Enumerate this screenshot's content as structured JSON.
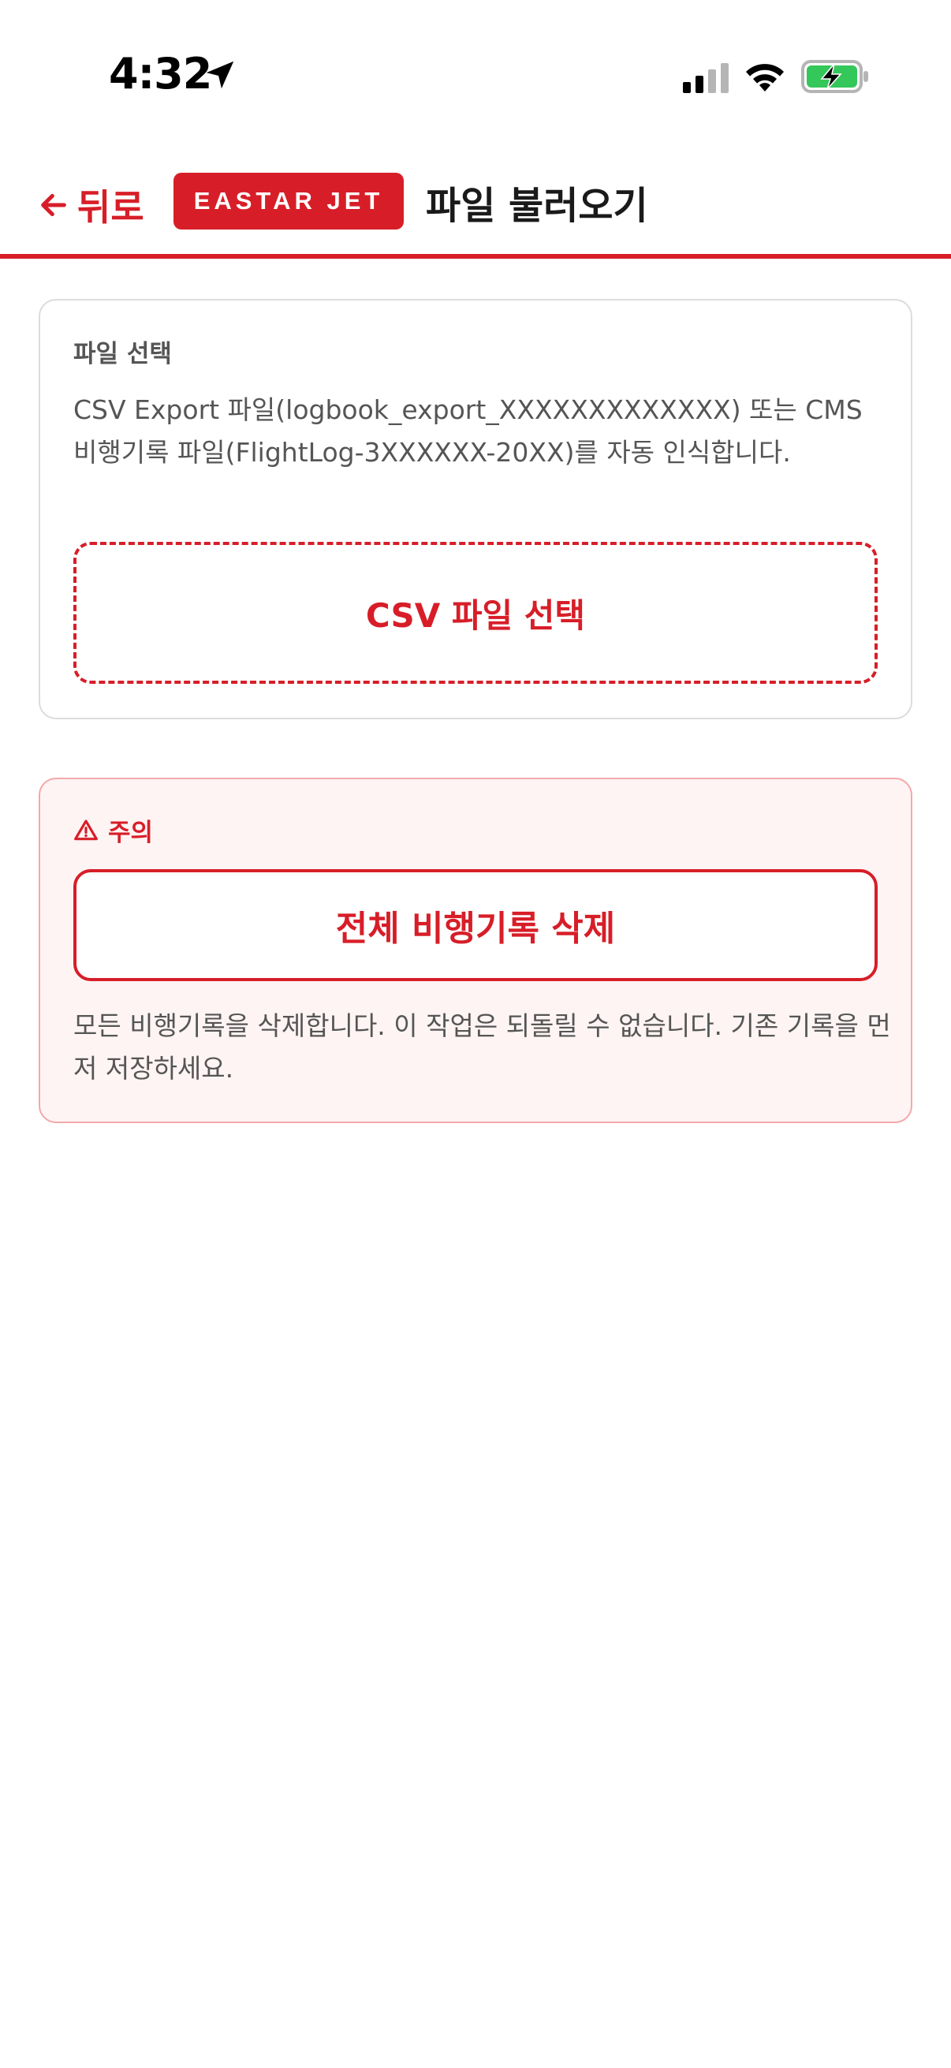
{
  "status_bar": {
    "time": "4:32",
    "icons": [
      "location-arrow-icon",
      "signal-icon",
      "wifi-icon",
      "battery-charging-icon"
    ]
  },
  "header": {
    "back_label": "뒤로",
    "brand": "EASTAR JET",
    "title": "파일 불러오기"
  },
  "file_section": {
    "label": "파일 선택",
    "description": "CSV Export 파일(logbook_export_XXXXXXXXXXXXX) 또는 CMS 비행기록 파일(FlightLog-3XXXXXX-20XX)를 자동 인식합니다.",
    "button_label": "CSV 파일 선택"
  },
  "warning_section": {
    "label": "주의",
    "button_label": "전체 비행기록 삭제",
    "description": "모든 비행기록을 삭제합니다. 이 작업은 되돌릴 수 없습니다. 기존 기록을 먼저 저장하세요."
  },
  "colors": {
    "accent": "#d71e28",
    "warning_bg": "#fff4f4",
    "warning_border": "#f3a8aa",
    "text_muted": "#555555"
  }
}
